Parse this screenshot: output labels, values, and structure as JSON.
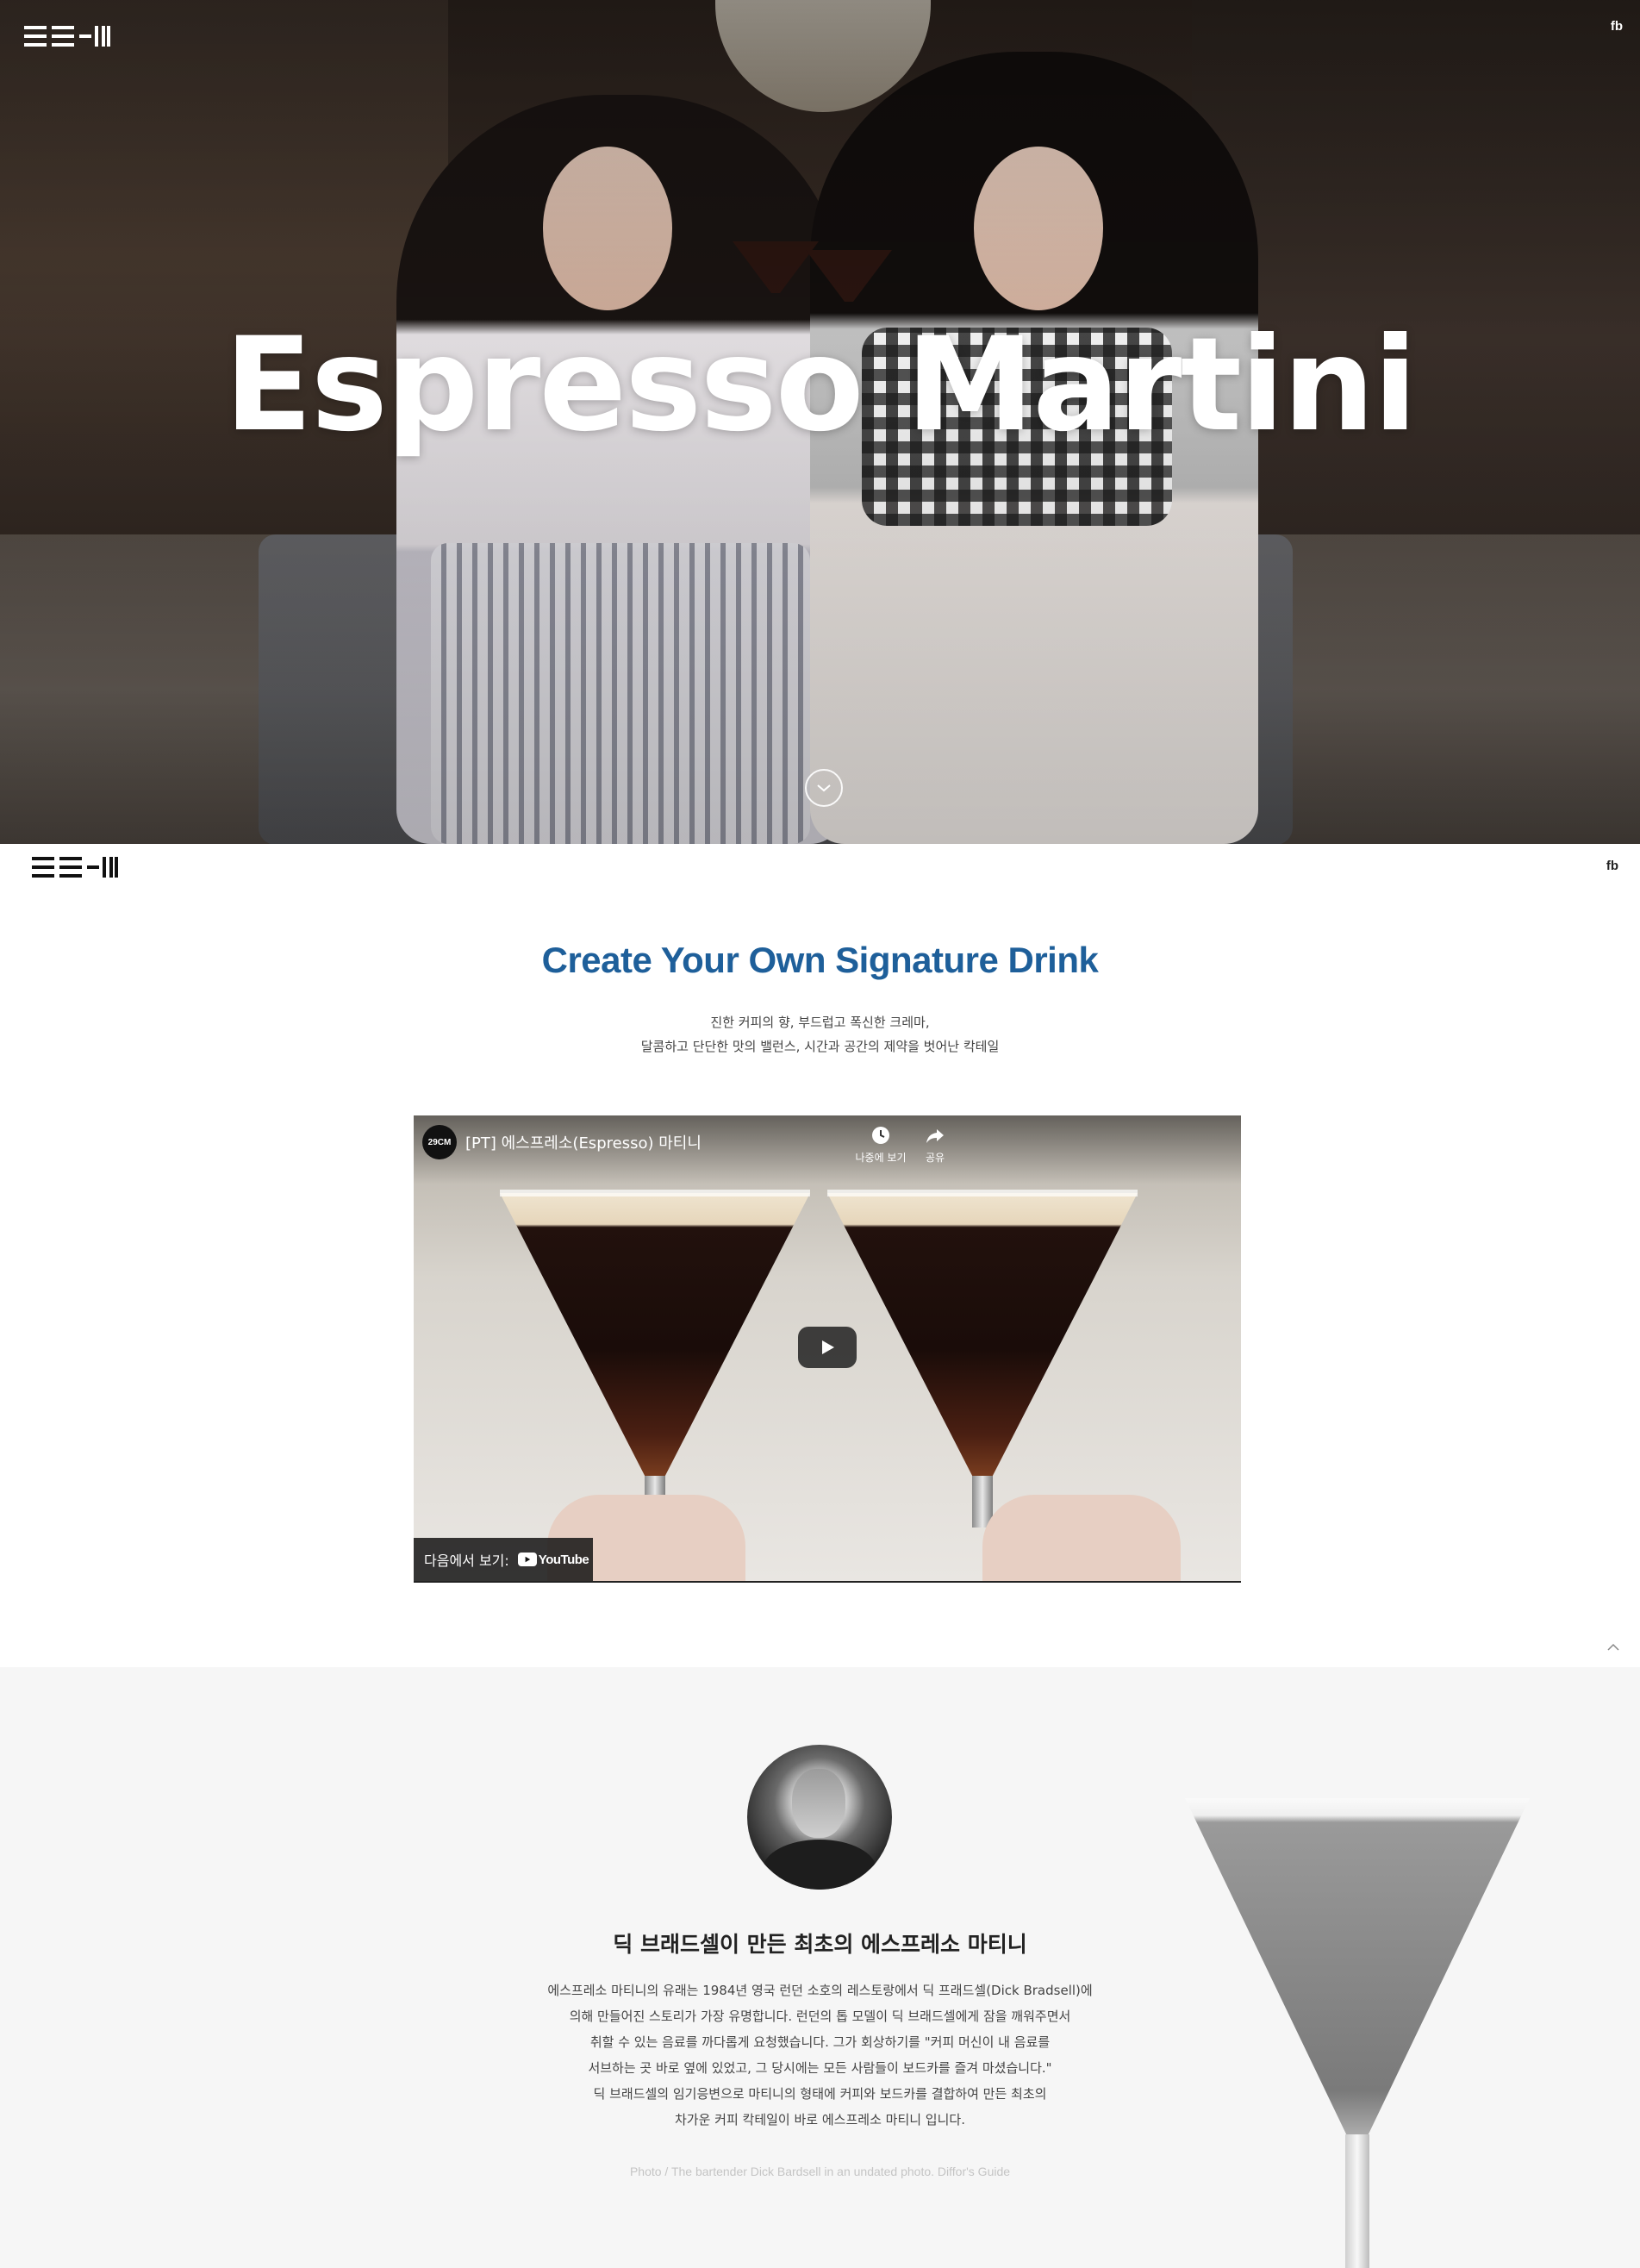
{
  "hero": {
    "title": "Espresso Martini",
    "fb_label": "fb",
    "scroll_icon": "chevron-down-icon"
  },
  "nav": {
    "fb_label": "fb"
  },
  "intro": {
    "title": "Create Your Own Signature Drink",
    "lines": [
      "진한 커피의 향, 부드럽고 폭신한 크레마,",
      "달콤하고 단단한 맛의 밸런스, 시간과 공간의 제약을 벗어난 칵테일"
    ]
  },
  "video": {
    "channel_badge": "29CM",
    "title": "[PT] 에스프레소(Espresso) 마티니",
    "watch_later_label": "나중에 보기",
    "share_label": "공유",
    "watch_on_label": "다음에서 보기:",
    "youtube_label": "YouTube"
  },
  "story": {
    "title": "딕 브래드셀이 만든 최초의 에스프레소 마티니",
    "lines": [
      "에스프레소 마티니의 유래는 1984년 영국 런던 소호의 레스토랑에서 딕 프래드셀(Dick Bradsell)에",
      "의해 만들어진 스토리가 가장 유명합니다. 런던의 톱 모델이 딕 브래드셀에게 잠을 깨워주면서",
      "취할 수 있는 음료를 까다롭게 요청했습니다. 그가 회상하기를 \"커피 머신이 내 음료를",
      "서브하는 곳 바로 옆에 있었고, 그 당시에는 모든 사람들이 보드카를 즐겨 마셨습니다.\"",
      "딕 브래드셀의 임기응변으로 마티니의 형태에 커피와 보드카를 결합하여 만든 최초의",
      "차가운 커피 칵테일이 바로 에스프레소 마티니 입니다."
    ],
    "credit": "Photo / The bartender Dick Bardsell in an undated photo. Diffor's Guide"
  },
  "colors": {
    "accent": "#1e5f9a",
    "story_bg": "#f6f6f6"
  }
}
